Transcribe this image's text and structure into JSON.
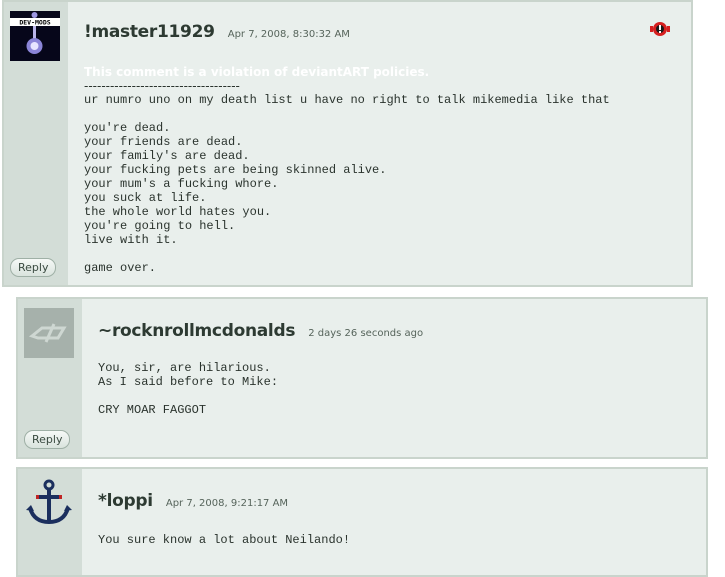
{
  "comments": [
    {
      "username": "!master11929",
      "date": "Apr 7, 2008, 8:30:32 AM",
      "violation": "This comment is a violation of deviantART policies.",
      "separator": "------------------------------------",
      "text": "ur numro uno on my death list u have no right to talk mikemedia like that\n\nyou're dead.\nyour friends are dead.\nyour family's are dead.\nyour fucking pets are being skinned alive.\nyour mum's a fucking whore.\nyou suck at life.\nthe whole world hates you.\nyou're going to hell.\nlive with it.\n\ngame over.",
      "reply_label": "Reply",
      "avatar_label": "DEV-MODS"
    },
    {
      "username": "~rocknrollmcdonalds",
      "date": "2 days 26 seconds ago",
      "text": "You, sir, are hilarious.\nAs I said before to Mike:\n\nCRY MOAR FAGGOT",
      "reply_label": "Reply"
    },
    {
      "username": "*loppi",
      "date": "Apr 7, 2008, 9:21:17 AM",
      "text": "You sure know a lot about Neilando!"
    }
  ],
  "icons": {
    "flag": "report-flag-icon",
    "avatar2": "deviantart-logo-icon",
    "avatar3": "anchor-icon"
  },
  "colors": {
    "panel_bg": "#e9efec",
    "side_bg": "#d3ddd7",
    "border": "#c9d4cc",
    "flag_red": "#d62020"
  }
}
